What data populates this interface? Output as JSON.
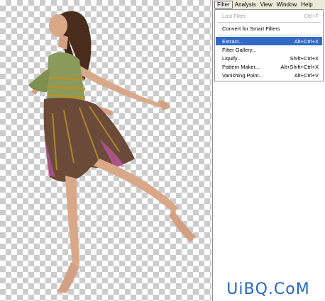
{
  "menubar": {
    "items": [
      "Filter",
      "Analysis",
      "View",
      "Window",
      "Help"
    ]
  },
  "filter_menu": {
    "last_filter": {
      "label": "Last Filter",
      "shortcut": "Ctrl+F"
    },
    "convert_smart": {
      "label": "Convert for Smart Filters"
    },
    "extract": {
      "label": "Extract...",
      "shortcut": "Alt+Ctrl+X"
    },
    "filter_gallery": {
      "label": "Filter Gallery..."
    },
    "liquify": {
      "label": "Liquify...",
      "shortcut": "Shift+Ctrl+X"
    },
    "pattern_maker": {
      "label": "Pattern Maker...",
      "shortcut": "Alt+Shift+Ctrl+X"
    },
    "vanishing_point": {
      "label": "Vanishing Point...",
      "shortcut": "Alt+Ctrl+V"
    }
  },
  "watermark": {
    "text": "UiBQ.CoM"
  },
  "colors": {
    "highlight": "#316ac5",
    "menubar_bg": "#ece9d8",
    "watermark": "#2467c6",
    "dress_bodice": "#8a9a5b",
    "skirt": "#6b4a3a",
    "skin": "#d9a889"
  }
}
